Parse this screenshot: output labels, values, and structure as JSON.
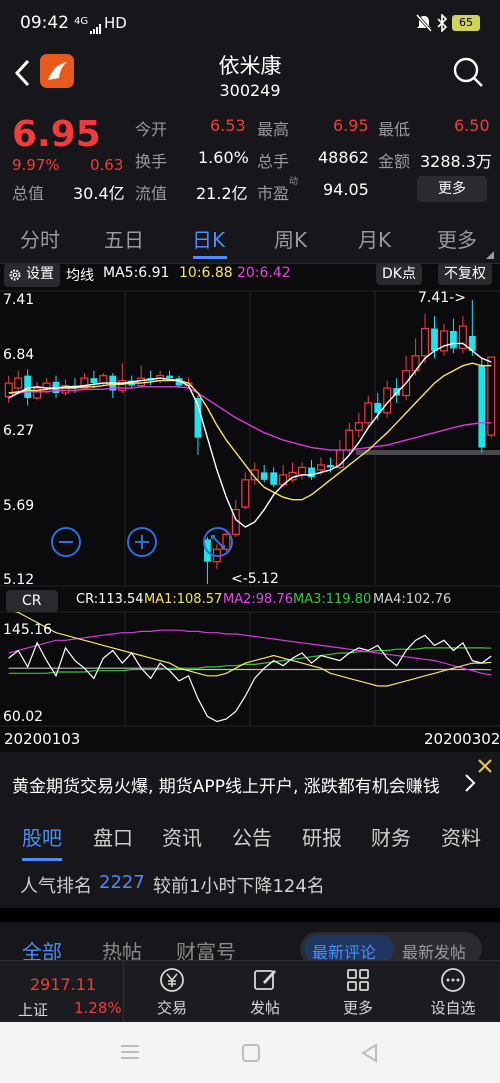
{
  "status": {
    "time": "09:42",
    "network": "4G",
    "hd": "HD",
    "battery": "65"
  },
  "header": {
    "name": "依米康",
    "code": "300249"
  },
  "quote": {
    "price": "6.95",
    "change_pct": "9.97%",
    "change": "0.63",
    "fields": [
      {
        "label": "今开",
        "value": "6.53",
        "red": true
      },
      {
        "label": "最高",
        "value": "6.95",
        "red": true
      },
      {
        "label": "最低",
        "value": "6.50",
        "red": true
      },
      {
        "label": "换手",
        "value": "1.60%",
        "red": false
      },
      {
        "label": "总手",
        "value": "48862",
        "red": false
      },
      {
        "label": "金额",
        "value": "3288.3万",
        "red": false
      },
      {
        "label": "总值",
        "value": "30.4亿",
        "red": false
      },
      {
        "label": "流值",
        "value": "21.2亿",
        "red": false
      },
      {
        "label": "市盈",
        "value": "94.05",
        "red": false
      }
    ],
    "pe_superscript": "动",
    "more_label": "更多"
  },
  "period_tabs": [
    "分时",
    "五日",
    "日K",
    "周K",
    "月K",
    "更多"
  ],
  "active_period": "日K",
  "chart_toolbar": {
    "settings": "设置",
    "ma_title": "均线",
    "ma5": "MA5:6.91",
    "ma10": "10:6.88",
    "ma20": "20:6.42",
    "dk": "DK点",
    "fq": "不复权"
  },
  "colors": {
    "up": "#f23b3b",
    "down": "#23e0ec",
    "ma5": "#ffffff",
    "ma10": "#f3e36b",
    "ma20": "#d63cd6",
    "accent": "#4f8df5"
  },
  "chart_data": {
    "type": "candlestick",
    "y_ticks": [
      "7.41",
      "6.84",
      "6.27",
      "5.69",
      "5.12"
    ],
    "ylim": [
      5.12,
      7.41
    ],
    "high_label": "7.41->",
    "low_label": "<-5.12",
    "candles": [
      {
        "o": 6.63,
        "c": 6.74,
        "h": 6.8,
        "l": 6.58
      },
      {
        "o": 6.7,
        "c": 6.78,
        "h": 6.84,
        "l": 6.66
      },
      {
        "o": 6.8,
        "c": 6.62,
        "h": 6.85,
        "l": 6.56
      },
      {
        "o": 6.62,
        "c": 6.7,
        "h": 6.75,
        "l": 6.6
      },
      {
        "o": 6.7,
        "c": 6.74,
        "h": 6.78,
        "l": 6.66
      },
      {
        "o": 6.75,
        "c": 6.66,
        "h": 6.8,
        "l": 6.62
      },
      {
        "o": 6.66,
        "c": 6.72,
        "h": 6.77,
        "l": 6.64
      },
      {
        "o": 6.72,
        "c": 6.7,
        "h": 6.78,
        "l": 6.66
      },
      {
        "o": 6.7,
        "c": 6.78,
        "h": 6.82,
        "l": 6.68
      },
      {
        "o": 6.78,
        "c": 6.74,
        "h": 6.84,
        "l": 6.7
      },
      {
        "o": 6.74,
        "c": 6.8,
        "h": 6.82,
        "l": 6.72
      },
      {
        "o": 6.8,
        "c": 6.68,
        "h": 6.82,
        "l": 6.62
      },
      {
        "o": 6.68,
        "c": 6.76,
        "h": 6.9,
        "l": 6.66
      },
      {
        "o": 6.76,
        "c": 6.72,
        "h": 6.8,
        "l": 6.7
      },
      {
        "o": 6.72,
        "c": 6.78,
        "h": 6.88,
        "l": 6.7
      },
      {
        "o": 6.78,
        "c": 6.76,
        "h": 6.84,
        "l": 6.72
      },
      {
        "o": 6.76,
        "c": 6.8,
        "h": 6.84,
        "l": 6.74
      },
      {
        "o": 6.8,
        "c": 6.78,
        "h": 6.84,
        "l": 6.76
      },
      {
        "o": 6.78,
        "c": 6.72,
        "h": 6.8,
        "l": 6.7
      },
      {
        "o": 6.72,
        "c": 6.74,
        "h": 6.78,
        "l": 6.7
      },
      {
        "o": 6.62,
        "c": 6.3,
        "h": 6.64,
        "l": 6.16
      },
      {
        "o": 5.48,
        "c": 5.3,
        "h": 5.5,
        "l": 5.12
      },
      {
        "o": 5.3,
        "c": 5.4,
        "h": 5.44,
        "l": 5.24
      },
      {
        "o": 5.4,
        "c": 5.52,
        "h": 5.56,
        "l": 5.36
      },
      {
        "o": 5.52,
        "c": 5.72,
        "h": 5.8,
        "l": 5.5
      },
      {
        "o": 5.74,
        "c": 5.96,
        "h": 6.02,
        "l": 5.72
      },
      {
        "o": 5.96,
        "c": 6.04,
        "h": 6.1,
        "l": 5.92
      },
      {
        "o": 6.02,
        "c": 5.96,
        "h": 6.08,
        "l": 5.94
      },
      {
        "o": 6.02,
        "c": 5.92,
        "h": 6.06,
        "l": 5.9
      },
      {
        "o": 5.92,
        "c": 6.0,
        "h": 6.08,
        "l": 5.9
      },
      {
        "o": 5.96,
        "c": 6.02,
        "h": 6.1,
        "l": 5.94
      },
      {
        "o": 6.0,
        "c": 6.06,
        "h": 6.1,
        "l": 5.96
      },
      {
        "o": 6.06,
        "c": 5.98,
        "h": 6.12,
        "l": 5.96
      },
      {
        "o": 6.04,
        "c": 6.08,
        "h": 6.14,
        "l": 6.0
      },
      {
        "o": 6.08,
        "c": 6.06,
        "h": 6.14,
        "l": 6.02
      },
      {
        "o": 6.06,
        "c": 6.2,
        "h": 6.28,
        "l": 6.04
      },
      {
        "o": 6.2,
        "c": 6.36,
        "h": 6.42,
        "l": 6.16
      },
      {
        "o": 6.36,
        "c": 6.42,
        "h": 6.5,
        "l": 6.3
      },
      {
        "o": 6.42,
        "c": 6.58,
        "h": 6.64,
        "l": 6.38
      },
      {
        "o": 6.58,
        "c": 6.5,
        "h": 6.66,
        "l": 6.44
      },
      {
        "o": 6.5,
        "c": 6.7,
        "h": 6.76,
        "l": 6.46
      },
      {
        "o": 6.7,
        "c": 6.64,
        "h": 6.78,
        "l": 6.58
      },
      {
        "o": 6.64,
        "c": 6.84,
        "h": 6.96,
        "l": 6.6
      },
      {
        "o": 6.84,
        "c": 6.96,
        "h": 7.1,
        "l": 6.8
      },
      {
        "o": 6.96,
        "c": 7.18,
        "h": 7.3,
        "l": 6.9
      },
      {
        "o": 7.18,
        "c": 7.0,
        "h": 7.28,
        "l": 6.94
      },
      {
        "o": 7.0,
        "c": 7.16,
        "h": 7.22,
        "l": 6.96
      },
      {
        "o": 7.16,
        "c": 7.02,
        "h": 7.26,
        "l": 6.98
      },
      {
        "o": 7.02,
        "c": 7.2,
        "h": 7.28,
        "l": 6.98
      },
      {
        "o": 7.12,
        "c": 7.0,
        "h": 7.41,
        "l": 6.96
      },
      {
        "o": 6.88,
        "c": 6.22,
        "h": 6.94,
        "l": 6.18
      },
      {
        "o": 6.32,
        "c": 6.95,
        "h": 6.95,
        "l": 6.3
      }
    ],
    "ma5": [
      6.62,
      6.66,
      6.7,
      6.71,
      6.7,
      6.7,
      6.71,
      6.71,
      6.72,
      6.73,
      6.74,
      6.74,
      6.74,
      6.75,
      6.76,
      6.77,
      6.78,
      6.77,
      6.76,
      6.72,
      6.56,
      6.3,
      6.04,
      5.82,
      5.64,
      5.58,
      5.62,
      5.72,
      5.84,
      5.92,
      5.98,
      6.0,
      6.0,
      6.02,
      6.04,
      6.08,
      6.16,
      6.26,
      6.38,
      6.48,
      6.58,
      6.66,
      6.74,
      6.84,
      6.94,
      7.0,
      7.04,
      7.06,
      7.06,
      7.0,
      6.94,
      6.91
    ],
    "ma10": [
      6.66,
      6.67,
      6.68,
      6.68,
      6.69,
      6.7,
      6.7,
      6.7,
      6.71,
      6.71,
      6.72,
      6.73,
      6.73,
      6.74,
      6.74,
      6.75,
      6.76,
      6.76,
      6.76,
      6.74,
      6.66,
      6.54,
      6.4,
      6.28,
      6.18,
      6.08,
      5.98,
      5.9,
      5.86,
      5.82,
      5.8,
      5.8,
      5.84,
      5.9,
      5.96,
      6.02,
      6.08,
      6.14,
      6.2,
      6.27,
      6.34,
      6.42,
      6.5,
      6.58,
      6.66,
      6.74,
      6.8,
      6.84,
      6.88,
      6.9,
      6.88,
      6.88
    ],
    "ma20": [
      6.66,
      6.66,
      6.67,
      6.67,
      6.67,
      6.68,
      6.68,
      6.68,
      6.69,
      6.69,
      6.69,
      6.7,
      6.7,
      6.7,
      6.71,
      6.71,
      6.71,
      6.71,
      6.71,
      6.7,
      6.66,
      6.61,
      6.56,
      6.51,
      6.46,
      6.42,
      6.38,
      6.34,
      6.31,
      6.28,
      6.26,
      6.24,
      6.22,
      6.21,
      6.2,
      6.2,
      6.2,
      6.21,
      6.22,
      6.23,
      6.24,
      6.26,
      6.28,
      6.3,
      6.32,
      6.34,
      6.36,
      6.38,
      6.4,
      6.41,
      6.42,
      6.42
    ],
    "cr": {
      "label": "CR",
      "cr": "CR:113.54",
      "ma1": "MA1:108.57",
      "ma2": "MA2:98.76",
      "ma3": "MA3:119.80",
      "ma4": "MA4:102.76",
      "y_top": "145.16",
      "y_bottom": "60.02",
      "ylim": [
        60.02,
        145.16
      ],
      "cr_values": [
        112,
        118,
        105,
        124,
        110,
        98,
        120,
        110,
        104,
        96,
        112,
        118,
        108,
        116,
        104,
        96,
        108,
        102,
        94,
        98,
        80,
        66,
        62,
        64,
        70,
        82,
        96,
        104,
        110,
        106,
        112,
        116,
        108,
        114,
        112,
        110,
        116,
        120,
        118,
        122,
        112,
        106,
        118,
        126,
        130,
        122,
        126,
        118,
        124,
        110,
        108,
        113.54
      ],
      "ma1_values": [
        150,
        148,
        144,
        140,
        136,
        132,
        130,
        128,
        126,
        124,
        122,
        120,
        118,
        116,
        114,
        112,
        110,
        108,
        104,
        102,
        100,
        98,
        98,
        100,
        104,
        108,
        110,
        112,
        114,
        112,
        110,
        108,
        106,
        104,
        100,
        98,
        96,
        94,
        92,
        90,
        90,
        92,
        94,
        96,
        98,
        100,
        102,
        104,
        106,
        108,
        108,
        108.57
      ],
      "ma2_values": [
        116,
        118,
        120,
        122,
        124,
        126,
        126,
        127,
        128,
        129,
        130,
        131,
        132,
        132,
        133,
        133,
        134,
        134,
        134,
        133,
        133,
        132,
        132,
        131,
        131,
        130,
        129,
        128,
        127,
        126,
        125,
        124,
        123,
        122,
        121,
        120,
        119,
        118,
        117,
        116,
        115,
        114,
        113,
        112,
        111,
        110,
        108,
        106,
        104,
        102,
        100,
        98.76
      ],
      "ma3_values": [
        100,
        100,
        100,
        100,
        100,
        101,
        101,
        101,
        101,
        102,
        102,
        102,
        102,
        103,
        103,
        103,
        103,
        104,
        104,
        104,
        104,
        105,
        105,
        106,
        106,
        107,
        107,
        108,
        109,
        110,
        111,
        112,
        113,
        114,
        115,
        116,
        116,
        117,
        117,
        118,
        118,
        119,
        119,
        119,
        120,
        120,
        120,
        120,
        120,
        120,
        120,
        119.8
      ],
      "ma4_values": [
        104,
        104,
        104,
        104,
        104,
        104,
        104,
        104,
        104,
        104,
        104,
        104,
        104,
        104,
        104,
        104,
        104,
        103,
        103,
        103,
        103,
        103,
        103,
        103,
        103,
        103,
        103,
        103,
        103,
        103,
        103,
        103,
        103,
        103,
        103,
        103,
        103,
        103,
        103,
        103,
        103,
        103,
        103,
        103,
        103,
        103,
        103,
        103,
        103,
        103,
        103,
        102.76
      ]
    },
    "x_start": "20200103",
    "x_end": "20200302"
  },
  "ad": {
    "text": "黄金期货交易火爆, 期货APP线上开户, 涨跌都有机会赚钱"
  },
  "sub_tabs": [
    "股吧",
    "盘口",
    "资讯",
    "公告",
    "研报",
    "财务",
    "资料"
  ],
  "active_sub_tab": "股吧",
  "rank": {
    "label": "人气排名",
    "value": "2227",
    "note": "较前1小时下降124名"
  },
  "feed_tabs": [
    "全部",
    "热帖",
    "财富号"
  ],
  "feed_sort": [
    "最新评论",
    "最新发帖"
  ],
  "bottom": {
    "index_value": "2917.11",
    "index_name": "上证",
    "index_pct": "1.28%",
    "actions": [
      "交易",
      "发帖",
      "更多",
      "设自选"
    ]
  }
}
